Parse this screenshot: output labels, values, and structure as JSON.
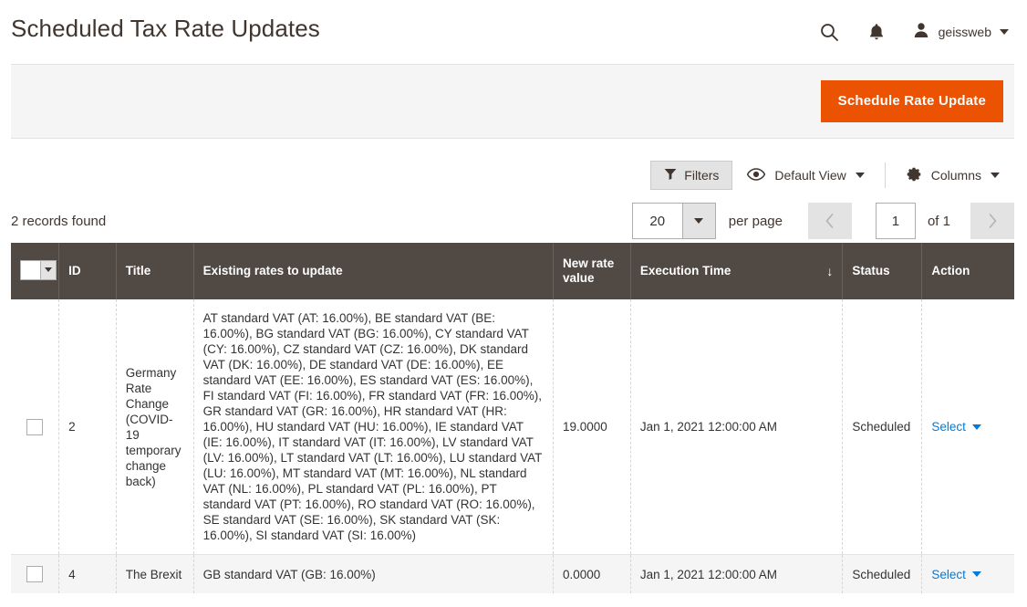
{
  "header": {
    "title": "Scheduled Tax Rate Updates",
    "search_icon": "search-icon",
    "notifications_icon": "bell-icon",
    "user_name": "geissweb"
  },
  "page_actions": {
    "primary_button": "Schedule Rate Update",
    "accent_color": "#eb5202"
  },
  "toolbar": {
    "filters_label": "Filters",
    "view_label": "Default View",
    "columns_label": "Columns"
  },
  "grid_info": {
    "records_found": "2 records found",
    "per_page_value": "20",
    "per_page_label": "per page",
    "page_value": "1",
    "of_label": "of 1",
    "prev_glyph": "‹",
    "next_glyph": "›"
  },
  "table": {
    "columns": [
      {
        "key": "check",
        "label": ""
      },
      {
        "key": "id",
        "label": "ID"
      },
      {
        "key": "title",
        "label": "Title"
      },
      {
        "key": "rates",
        "label": "Existing rates to update"
      },
      {
        "key": "newrate",
        "label": "New rate value"
      },
      {
        "key": "exec",
        "label": "Execution Time",
        "sort": "↓"
      },
      {
        "key": "status",
        "label": "Status"
      },
      {
        "key": "action",
        "label": "Action"
      }
    ],
    "rows": [
      {
        "id": "2",
        "title": "Germany Rate Change (COVID-19 temporary change back)",
        "rates": "AT standard VAT (AT: 16.00%), BE standard VAT (BE: 16.00%), BG standard VAT (BG: 16.00%), CY standard VAT (CY: 16.00%), CZ standard VAT (CZ: 16.00%), DK standard VAT (DK: 16.00%), DE standard VAT (DE: 16.00%), EE standard VAT (EE: 16.00%), ES standard VAT (ES: 16.00%), FI standard VAT (FI: 16.00%), FR standard VAT (FR: 16.00%), GR standard VAT (GR: 16.00%), HR standard VAT (HR: 16.00%), HU standard VAT (HU: 16.00%), IE standard VAT (IE: 16.00%), IT standard VAT (IT: 16.00%), LV standard VAT (LV: 16.00%), LT standard VAT (LT: 16.00%), LU standard VAT (LU: 16.00%), MT standard VAT (MT: 16.00%), NL standard VAT (NL: 16.00%), PL standard VAT (PL: 16.00%), PT standard VAT (PT: 16.00%), RO standard VAT (RO: 16.00%), SE standard VAT (SE: 16.00%), SK standard VAT (SK: 16.00%), SI standard VAT (SI: 16.00%)",
        "newrate": "19.0000",
        "exec": "Jan 1, 2021 12:00:00 AM",
        "status": "Scheduled",
        "action": "Select"
      },
      {
        "id": "4",
        "title": "The Brexit",
        "rates": "GB standard VAT (GB: 16.00%)",
        "newrate": "0.0000",
        "exec": "Jan 1, 2021 12:00:00 AM",
        "status": "Scheduled",
        "action": "Select"
      }
    ]
  }
}
